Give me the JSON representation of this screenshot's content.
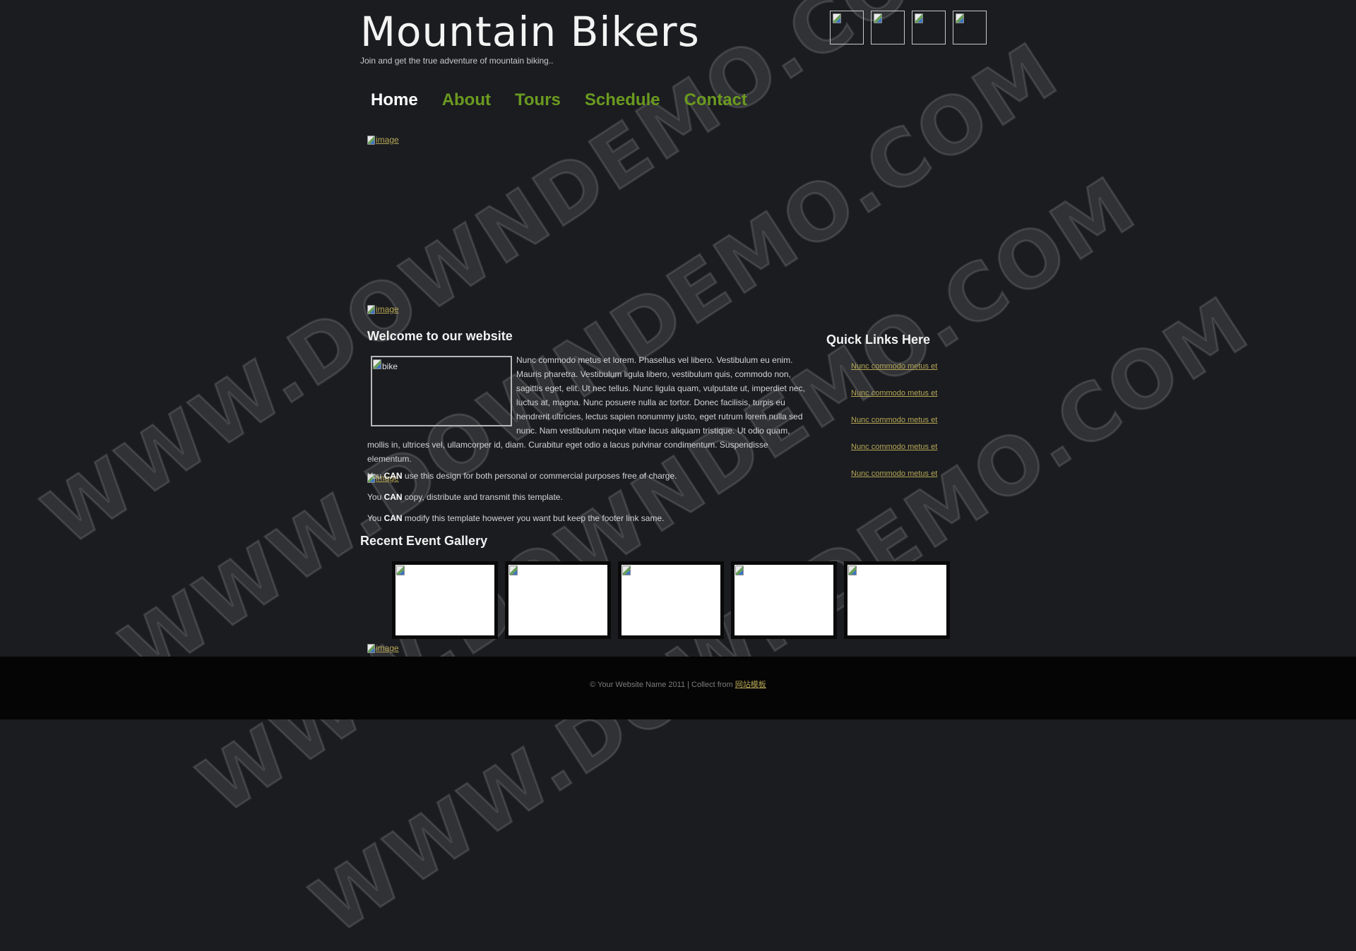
{
  "header": {
    "title": "Mountain Bikers",
    "tagline": "Join and get the true adventure of mountain biking.."
  },
  "social": [
    {
      "icon": "social-icon-1"
    },
    {
      "icon": "social-icon-2"
    },
    {
      "icon": "social-icon-3"
    },
    {
      "icon": "social-icon-4"
    }
  ],
  "nav": [
    {
      "label": "Home",
      "active": true
    },
    {
      "label": "About",
      "active": false
    },
    {
      "label": "Tours",
      "active": false
    },
    {
      "label": "Schedule",
      "active": false
    },
    {
      "label": "Contact",
      "active": false
    }
  ],
  "image_placeholder_alt": "image",
  "main": {
    "welcome_title": "Welcome to our website",
    "bike_alt": "bike",
    "paragraph": "Nunc commodo metus et lorem. Phasellus vel libero. Vestibulum eu enim. Mauris pharetra. Vestibulum ligula libero, vestibulum quis, commodo non, sagittis eget, elit. Ut nec tellus. Nunc ligula quam, vulputate ut, imperdiet nec, luctus at, magna. Nunc posuere nulla ac tortor. Donec facilisis, turpis eu hendrerit ultricies, lectus sapien nonummy justo, eget rutrum lorem nulla sed nunc. Nam vestibulum neque vitae lacus aliquam tristique. Ut odio quam, mollis in, ultrices vel, ullamcorper id, diam. Curabitur eget odio a lacus pulvinar condimentum. Suspendisse elementum.",
    "can_lines": [
      {
        "prefix": "You ",
        "bold": "CAN",
        "suffix": " use this design for both personal or commercial purposes free of charge."
      },
      {
        "prefix": "You ",
        "bold": "CAN",
        "suffix": " copy, distribute and transmit this template."
      },
      {
        "prefix": "You ",
        "bold": "CAN",
        "suffix": " modify this template however you want but keep the footer link same."
      }
    ]
  },
  "quick_links": {
    "title": "Quick Links Here",
    "items": [
      "Nunc commodo metus et",
      "Nunc commodo metus et",
      "Nunc commodo metus et",
      "Nunc commodo metus et",
      "Nunc commodo metus et"
    ]
  },
  "gallery": {
    "title": "Recent Event Gallery",
    "count": 5
  },
  "footer": {
    "text": "© Your Website Name 2011 | Collect from ",
    "link_label": "网站模板"
  },
  "watermark": "WWW.DOWNDEMO.COM"
}
